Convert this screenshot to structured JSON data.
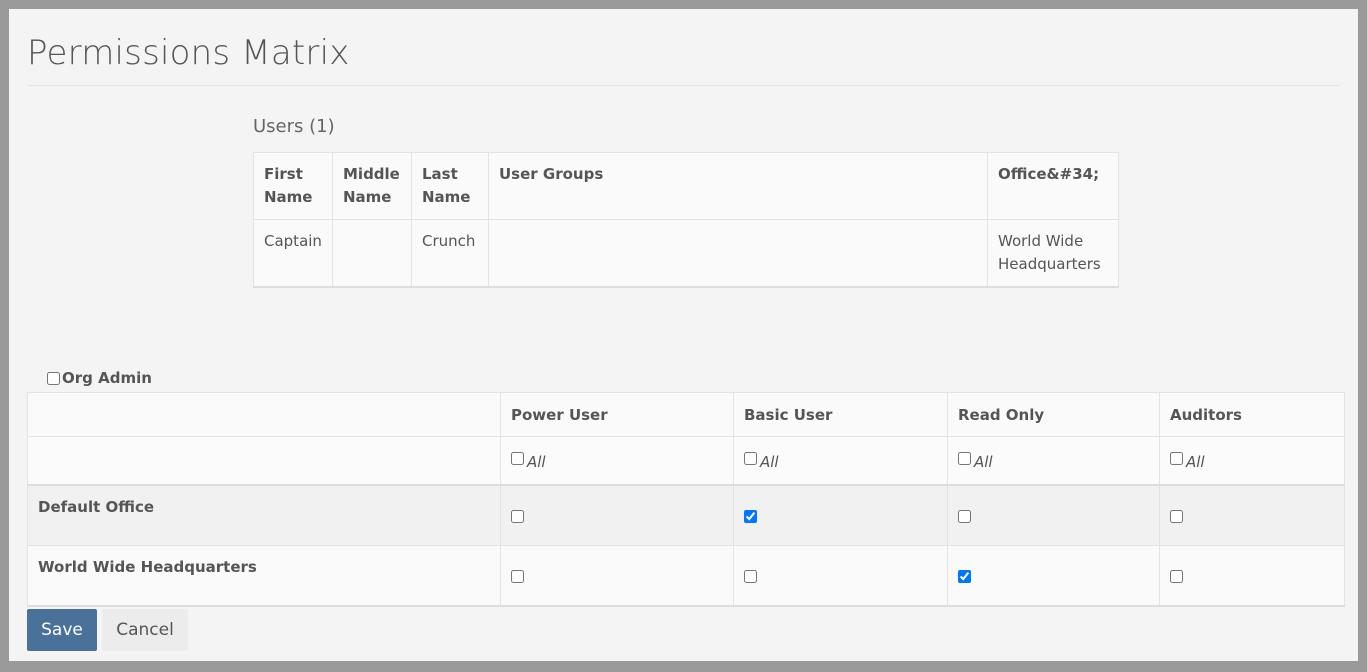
{
  "page": {
    "title": "Permissions Matrix"
  },
  "users": {
    "heading": "Users (1)",
    "columns": [
      "First Name",
      "Middle Name",
      "Last Name",
      "User Groups",
      "Office&#34;"
    ],
    "rows": [
      {
        "first": "Captain",
        "middle": "",
        "last": "Crunch",
        "groups": "",
        "office": "World Wide Headquarters"
      }
    ]
  },
  "org_admin": {
    "label": "Org Admin",
    "checked": false
  },
  "permissions": {
    "columns": [
      "",
      "Power User",
      "Basic User",
      "Read Only",
      "Auditors"
    ],
    "all_label": "All",
    "rows": [
      {
        "office": "Default Office",
        "power_user": false,
        "basic_user": true,
        "read_only": false,
        "auditors": false
      },
      {
        "office": "World Wide Headquarters",
        "power_user": false,
        "basic_user": false,
        "read_only": true,
        "auditors": false
      }
    ]
  },
  "actions": {
    "save_label": "Save",
    "cancel_label": "Cancel"
  },
  "colors": {
    "primary_button": "#4a7199",
    "checkbox_checked": "#1a73e8"
  }
}
